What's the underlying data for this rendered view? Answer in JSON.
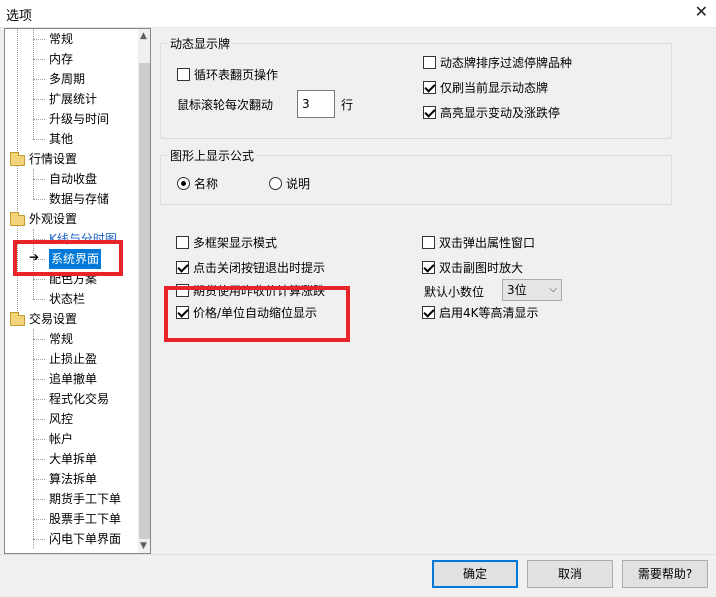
{
  "window": {
    "title": "选项",
    "close_glyph": "✕"
  },
  "tree": {
    "items": [
      {
        "label": "常规"
      },
      {
        "label": "内存"
      },
      {
        "label": "多周期"
      },
      {
        "label": "扩展统计"
      },
      {
        "label": "升级与时间"
      },
      {
        "label": "其他"
      },
      {
        "label": "行情设置"
      },
      {
        "label": "自动收盘"
      },
      {
        "label": "数据与存储"
      },
      {
        "label": "外观设置"
      },
      {
        "label": "K线与分时图"
      },
      {
        "label": "系统界面"
      },
      {
        "label": "配色方案"
      },
      {
        "label": "状态栏"
      },
      {
        "label": "交易设置"
      },
      {
        "label": "常规"
      },
      {
        "label": "止损止盈"
      },
      {
        "label": "追单撤单"
      },
      {
        "label": "程式化交易"
      },
      {
        "label": "风控"
      },
      {
        "label": "帐户"
      },
      {
        "label": "大单拆单"
      },
      {
        "label": "算法拆单"
      },
      {
        "label": "期货手工下单"
      },
      {
        "label": "股票手工下单"
      },
      {
        "label": "闪电下单界面"
      }
    ],
    "selected_index": 11
  },
  "dynamic_board": {
    "title": "动态显示牌",
    "loop_page": {
      "label": "循环表翻页操作",
      "checked": false
    },
    "wheel_label": "鼠标滚轮每次翻动",
    "wheel_value": "3",
    "wheel_unit": "行",
    "filter_suspended": {
      "label": "动态牌排序过滤停牌品种",
      "checked": false
    },
    "refresh_current": {
      "label": "仅刷当前显示动态牌",
      "checked": true
    },
    "highlight_changes": {
      "label": "高亮显示变动及涨跌停",
      "checked": true
    }
  },
  "formula": {
    "title": "图形上显示公式",
    "name_option": {
      "label": "名称",
      "selected": true
    },
    "desc_option": {
      "label": "说明",
      "selected": false
    }
  },
  "options": {
    "multi_frame": {
      "label": "多框架显示模式",
      "checked": false
    },
    "close_prompt": {
      "label": "点击关闭按钮退出时提示",
      "checked": true
    },
    "futures_prev_settle": {
      "label": "期货使用昨收价计算涨跌",
      "checked": false
    },
    "auto_shrink": {
      "label": "价格/单位自动缩位显示",
      "checked": true
    },
    "dblclick_popup": {
      "label": "双击弹出属性窗口",
      "checked": false
    },
    "dblclick_enlarge": {
      "label": "双击副图时放大",
      "checked": true
    },
    "decimal_label": "默认小数位",
    "decimal_value": "3位",
    "enable_4k": {
      "label": "启用4K等高清显示",
      "checked": true
    }
  },
  "buttons": {
    "ok": "确定",
    "cancel": "取消",
    "help": "需要帮助?"
  },
  "colors": {
    "highlight": "#e8242b",
    "primary": "#0078d7"
  }
}
